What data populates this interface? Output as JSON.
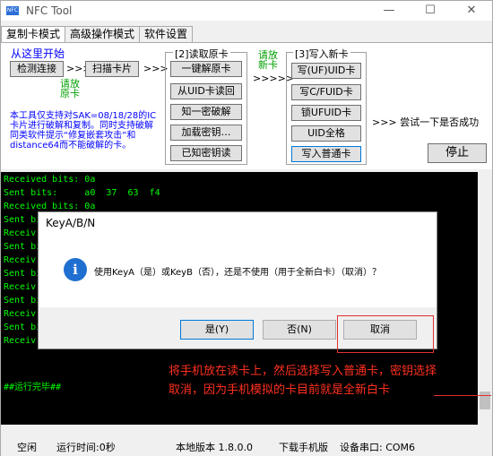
{
  "window": {
    "app_icon_text": "NFC",
    "title": "NFC Tool",
    "minimize": "—",
    "maximize": "☐",
    "close": "✕"
  },
  "tabs": [
    "复制卡模式",
    "高级操作模式",
    "软件设置"
  ],
  "panel": {
    "start_label": "从这里开始",
    "detect_button": "检测连接",
    "scan_button": "扫描卡片",
    "arrows_small": ">>>",
    "arrows_large": ">>>>>",
    "arrows_final": ">>> 尝试一下是否成功",
    "place_original": "请放\n原卡",
    "place_new": "请放\n新卡",
    "step2_title": "[2]读取原卡",
    "step3_title": "[3]写入新卡",
    "read_buttons": [
      "一键解原卡",
      "从UID卡读回",
      "知一密破解",
      "加载密钥…",
      "已知密钥读"
    ],
    "write_buttons": [
      "写(UF)UID卡",
      "写C/FUID卡",
      "锁UFUID卡",
      "UID全格",
      "写入普通卡"
    ],
    "stop_button": "停止",
    "notice": "本工具仅支持对SAK=08/18/28的IC卡片进行破解和复制。同时支持破解同类软件提示“修复嵌套攻击”和distance64而不能破解的卡。"
  },
  "console": {
    "lines": [
      "Received bits: 0a",
      "Sent bits:     a0  37  63  f4",
      "Received bits: 0a",
      "Sent bi",
      "Receiv",
      "Sent bi",
      "Receiv",
      "Sent bi",
      "Receiv",
      "Sent bi",
      "Receiv",
      "Sent bi",
      "Receiv",
      "",
      "",
      "##运行完毕##"
    ]
  },
  "status": {
    "state": "空闲",
    "runtime": "运行时间:0秒",
    "version": "本地版本 1.8.0.0",
    "download": "下载手机版",
    "port": "设备串口: COM6"
  },
  "dialog": {
    "title": "KeyA/B/N",
    "icon": "i",
    "message": "使用KeyA（是）或KeyB（否），还是不使用（用于全新白卡）（取消）？",
    "yes": "是(Y)",
    "no": "否(N)",
    "cancel": "取消"
  },
  "annotation": {
    "text": "将手机放在读卡上，然后选择写入普通卡，密钥选择取消，因为手机模拟的卡目前就是全新白卡"
  }
}
